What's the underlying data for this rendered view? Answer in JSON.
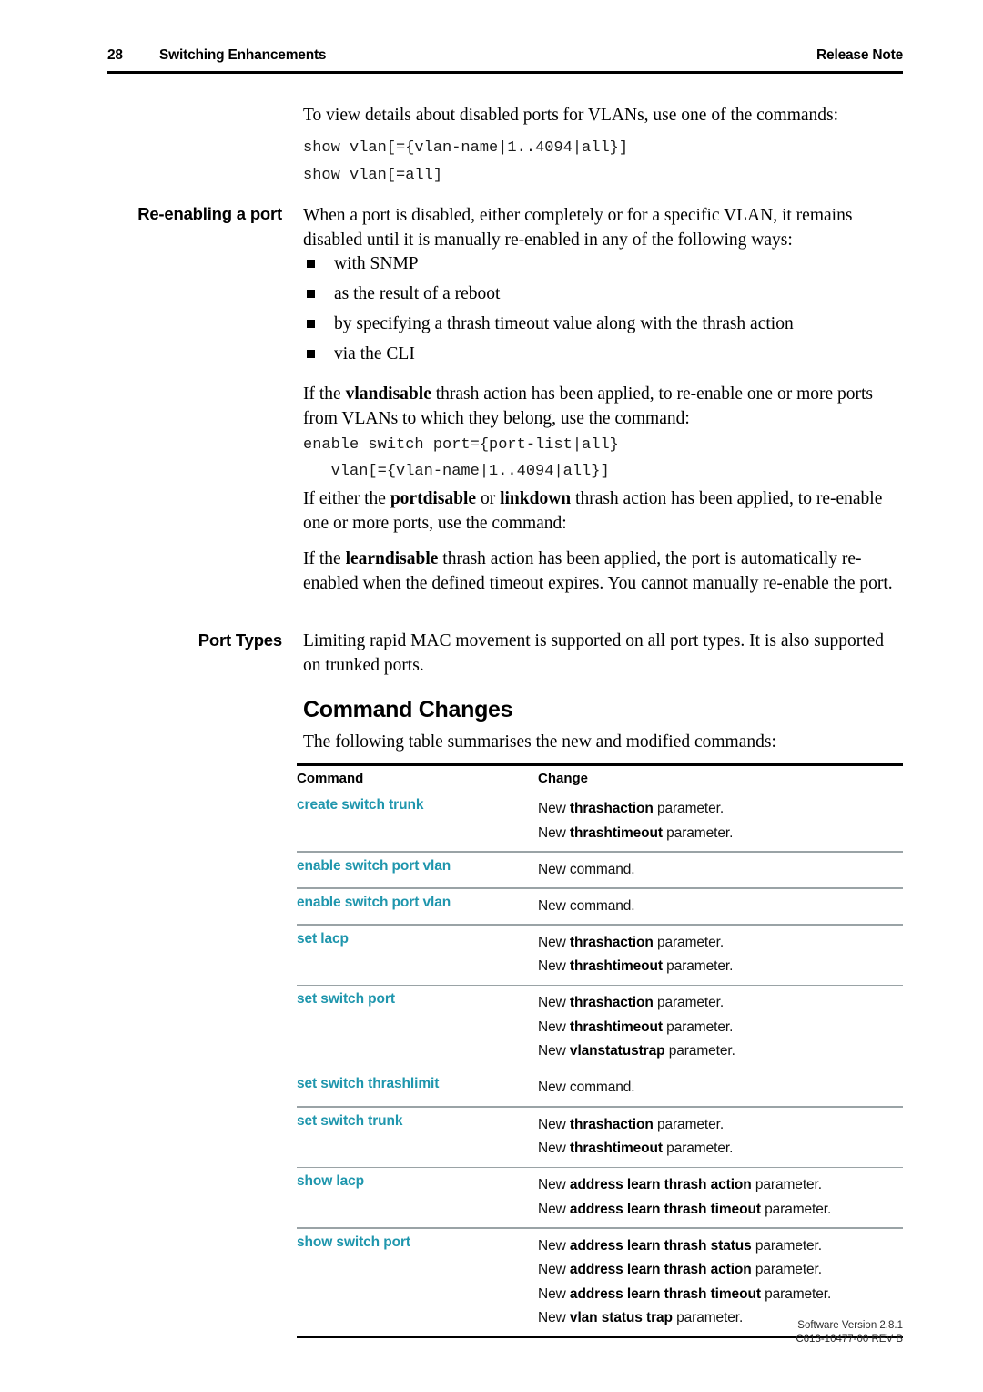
{
  "header": {
    "page_number": "28",
    "chapter": "Switching Enhancements",
    "doc_type": "Release Note"
  },
  "intro": {
    "paragraph": "To view details about disabled ports for VLANs, use one of the commands:",
    "command_1": "show vlan[={vlan-name|1..4094|all}]",
    "command_2": "show vlan[=all]"
  },
  "reenabling": {
    "side_heading": "Re-enabling a port",
    "paragraph": "When a port is disabled, either completely or for a specific VLAN, it remains disabled until it is manually re-enabled in any of the following ways:",
    "bullets": [
      "with SNMP",
      "as the result of a reboot",
      "by specifying a thrash timeout value along with the thrash action",
      "via the CLI"
    ],
    "vlandisable_text_1": "If the ",
    "vlandisable_bold": "vlandisable",
    "vlandisable_text_2": " thrash action has been applied, to re-enable one or more ports from VLANs to which they belong, use the command:",
    "vlandisable_command": "enable switch port={port-list|all}\n   vlan[={vlan-name|1..4094|all}]",
    "portdisable_text_1": "If either the ",
    "portdisable_bold_1": "portdisable",
    "portdisable_text_2": " or ",
    "portdisable_bold_2": "linkdown",
    "portdisable_text_3": " thrash action has been applied, to re-enable one or more ports, use the command:",
    "learndisable_text_1": "If the ",
    "learndisable_bold": "learndisable",
    "learndisable_text_2": " thrash action has been applied, the port is automatically re-enabled when the defined timeout expires. You cannot manually re-enable the port."
  },
  "port_types": {
    "side_heading": "Port Types",
    "paragraph": "Limiting rapid MAC  movement is supported on all port types. It is also supported on trunked ports."
  },
  "command_changes": {
    "heading": "Command Changes",
    "intro": "The following table summarises the new and modified commands:",
    "columns": [
      "Command",
      "Change"
    ],
    "accent_color": "#1f96ad",
    "rows": [
      {
        "command": "create switch trunk",
        "changes": [
          {
            "prefix": "New ",
            "bold": "thrashaction",
            "suffix": " parameter."
          },
          {
            "prefix": "New ",
            "bold": "thrashtimeout",
            "suffix": " parameter."
          }
        ]
      },
      {
        "command": "enable switch port vlan",
        "changes": [
          {
            "prefix": "New command.",
            "bold": "",
            "suffix": ""
          }
        ]
      },
      {
        "command": "enable switch port vlan",
        "changes": [
          {
            "prefix": "New command.",
            "bold": "",
            "suffix": ""
          }
        ]
      },
      {
        "command": "set lacp",
        "changes": [
          {
            "prefix": "New ",
            "bold": "thrashaction",
            "suffix": " parameter."
          },
          {
            "prefix": "New ",
            "bold": "thrashtimeout",
            "suffix": " parameter."
          }
        ]
      },
      {
        "command": "set switch port",
        "changes": [
          {
            "prefix": "New ",
            "bold": "thrashaction",
            "suffix": " parameter."
          },
          {
            "prefix": "New ",
            "bold": "thrashtimeout",
            "suffix": " parameter."
          },
          {
            "prefix": "New ",
            "bold": "vlanstatustrap",
            "suffix": " parameter."
          }
        ]
      },
      {
        "command": "set switch thrashlimit",
        "changes": [
          {
            "prefix": "New command.",
            "bold": "",
            "suffix": ""
          }
        ]
      },
      {
        "command": "set switch trunk",
        "changes": [
          {
            "prefix": "New ",
            "bold": "thrashaction",
            "suffix": " parameter."
          },
          {
            "prefix": "New ",
            "bold": "thrashtimeout",
            "suffix": " parameter."
          }
        ]
      },
      {
        "command": "show lacp",
        "changes": [
          {
            "prefix": "New ",
            "bold": "address learn thrash action",
            "suffix": " parameter."
          },
          {
            "prefix": "New ",
            "bold": "address learn thrash timeout",
            "suffix": " parameter."
          }
        ]
      },
      {
        "command": "show switch port",
        "changes": [
          {
            "prefix": "New ",
            "bold": "address learn thrash status",
            "suffix": " parameter."
          },
          {
            "prefix": "New ",
            "bold": "address learn thrash action",
            "suffix": " parameter."
          },
          {
            "prefix": "New ",
            "bold": "address learn thrash timeout",
            "suffix": " parameter."
          },
          {
            "prefix": "New ",
            "bold": "vlan status trap",
            "suffix": " parameter."
          }
        ]
      }
    ]
  },
  "footer": {
    "line1": "Software Version 2.8.1",
    "line2": "C613-10477-00 REV B"
  }
}
